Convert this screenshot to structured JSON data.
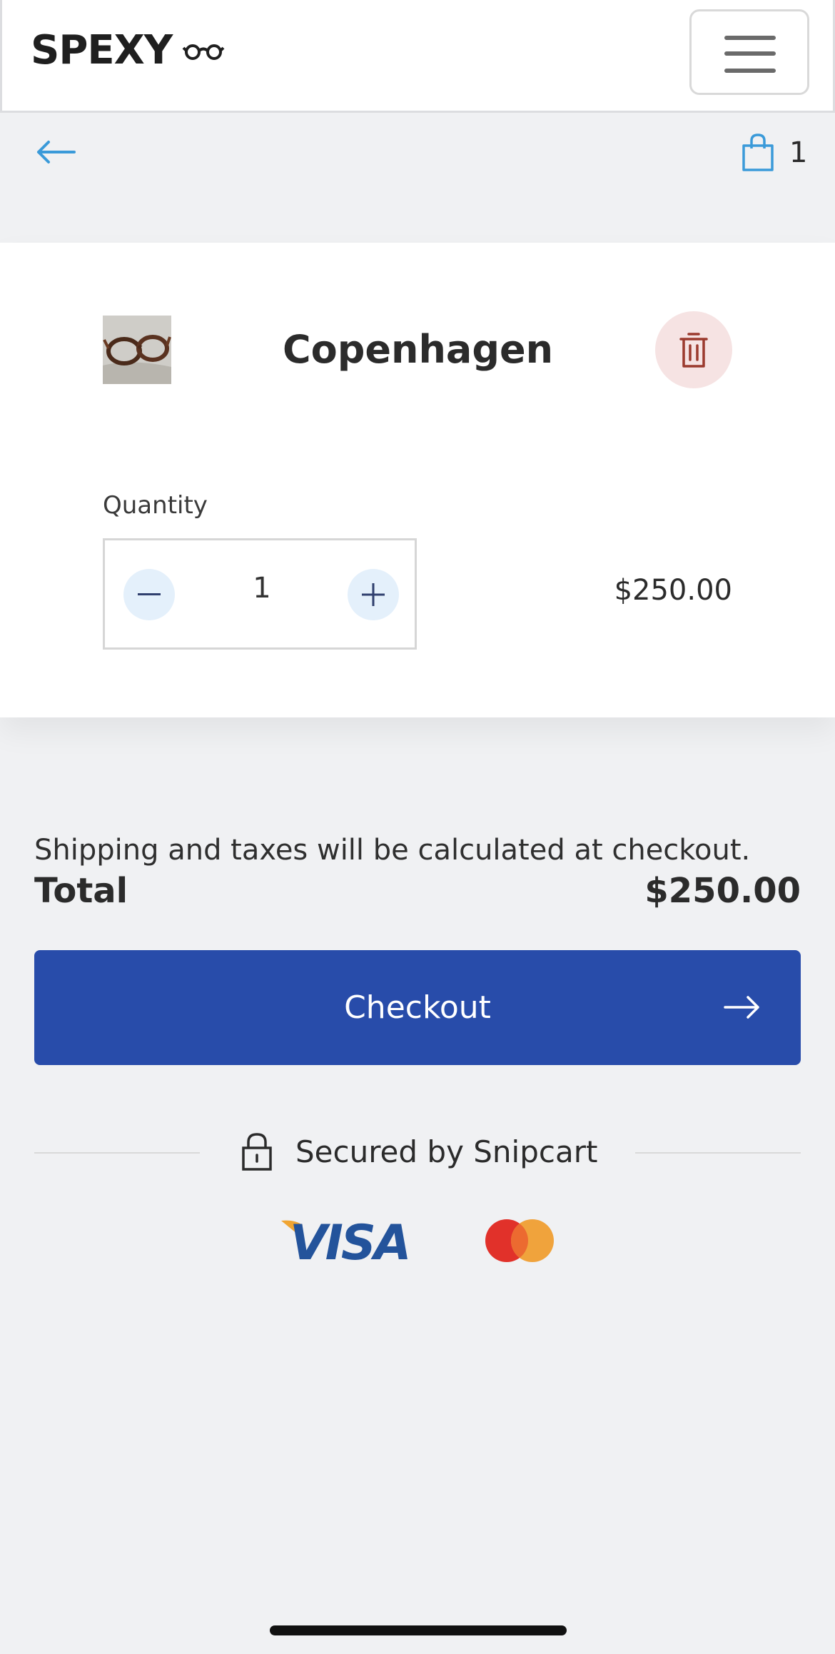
{
  "header": {
    "logo_text": "SPEXY",
    "logo_icon": "glasses-icon",
    "menu_icon": "hamburger-icon"
  },
  "nav": {
    "back_icon": "arrow-left-icon",
    "cart_icon": "shopping-bag-icon",
    "cart_count": "1"
  },
  "cart_item": {
    "name": "Copenhagen",
    "thumbnail": "glasses-product-image",
    "delete_icon": "trash-icon",
    "quantity_label": "Quantity",
    "quantity": "1",
    "price": "$250.00"
  },
  "summary": {
    "shipping_note": "Shipping and taxes will be calculated at checkout.",
    "total_label": "Total",
    "total_value": "$250.00"
  },
  "checkout": {
    "label": "Checkout",
    "arrow_icon": "arrow-right-icon"
  },
  "security": {
    "lock_icon": "lock-icon",
    "text": "Secured by Snipcart"
  },
  "payment_methods": [
    "visa-logo",
    "mastercard-logo"
  ],
  "colors": {
    "primary": "#284caa",
    "accent": "#3a9ad9",
    "delete_bg": "#f6e3e3",
    "delete_icon": "#9b3a2e",
    "page_bg": "#f0f1f3"
  }
}
